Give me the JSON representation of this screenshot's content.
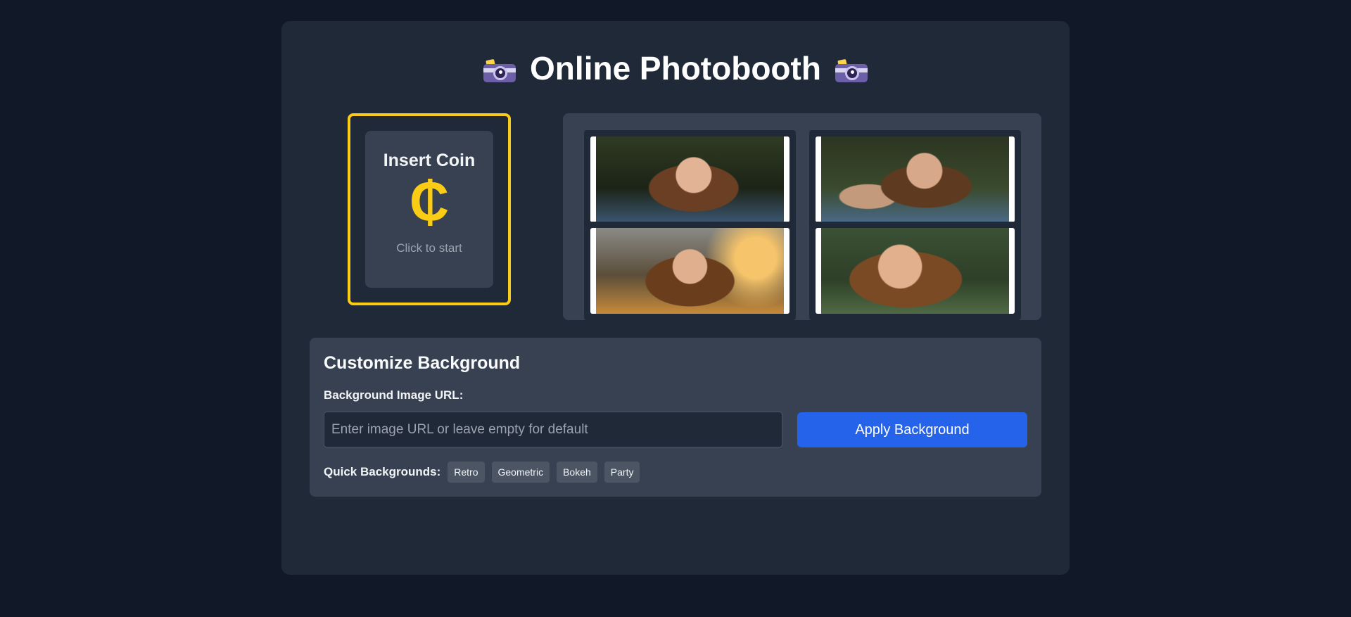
{
  "header": {
    "title": "Online Photobooth",
    "icon": "camera-with-flash-icon"
  },
  "coin": {
    "label": "Insert Coin",
    "symbol": "₵",
    "hint": "Click to start"
  },
  "gallery": {
    "photos": [
      {
        "alt": "smiling girl portrait outdoors"
      },
      {
        "alt": "girl taking selfie with phone"
      },
      {
        "alt": "girl portrait at sunset"
      },
      {
        "alt": "girl close-up portrait in park"
      }
    ]
  },
  "customize": {
    "title": "Customize Background",
    "url_label": "Background Image URL:",
    "url_value": "",
    "url_placeholder": "Enter image URL or leave empty for default",
    "apply_label": "Apply Background",
    "quick_label": "Quick Backgrounds:",
    "quick_options": [
      "Retro",
      "Geometric",
      "Bokeh",
      "Party"
    ]
  },
  "colors": {
    "page_bg": "#111827",
    "panel_bg": "#1f2937",
    "accent_yellow": "#facc15",
    "button_blue": "#2563eb"
  }
}
